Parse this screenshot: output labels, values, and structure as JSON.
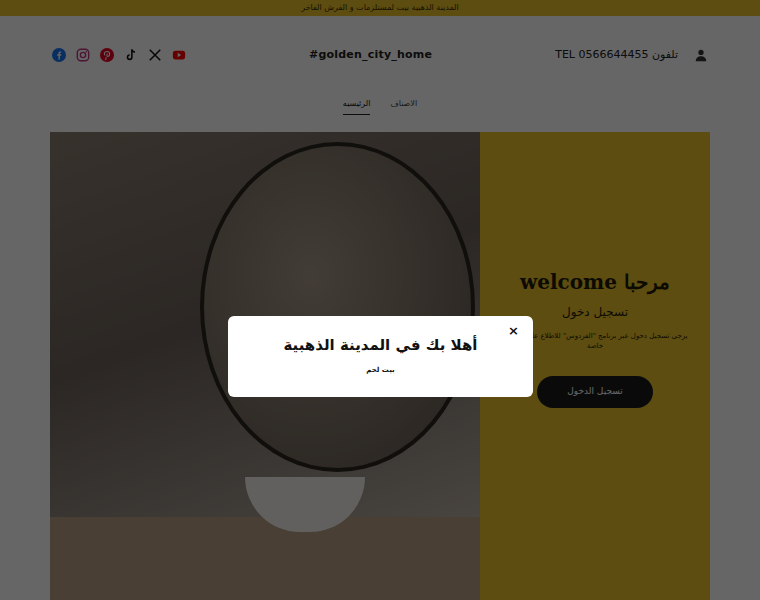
{
  "announcement": "المدينة الذهبية بيت لمستلزمات و الفرش الفاخر",
  "header": {
    "logo": "#golden_city_home",
    "phone": "TEL 0566644455 تلفون"
  },
  "nav": [
    {
      "label": "الرئيسيه",
      "selected": true
    },
    {
      "label": "الاصناف",
      "selected": false
    }
  ],
  "hero": {
    "title": "welcome مرحبا",
    "subtitle": "تسجيل دخول",
    "body": "يرجى تسجيل دخول عبر برنامج \"الفردوس\" للاطلاع على منتجات خاصة",
    "button": "تسجيل الدخول"
  },
  "modal": {
    "close": "×",
    "title": "أهلا بك في المدينة الذهبية",
    "subtitle": "بيت لحم"
  }
}
